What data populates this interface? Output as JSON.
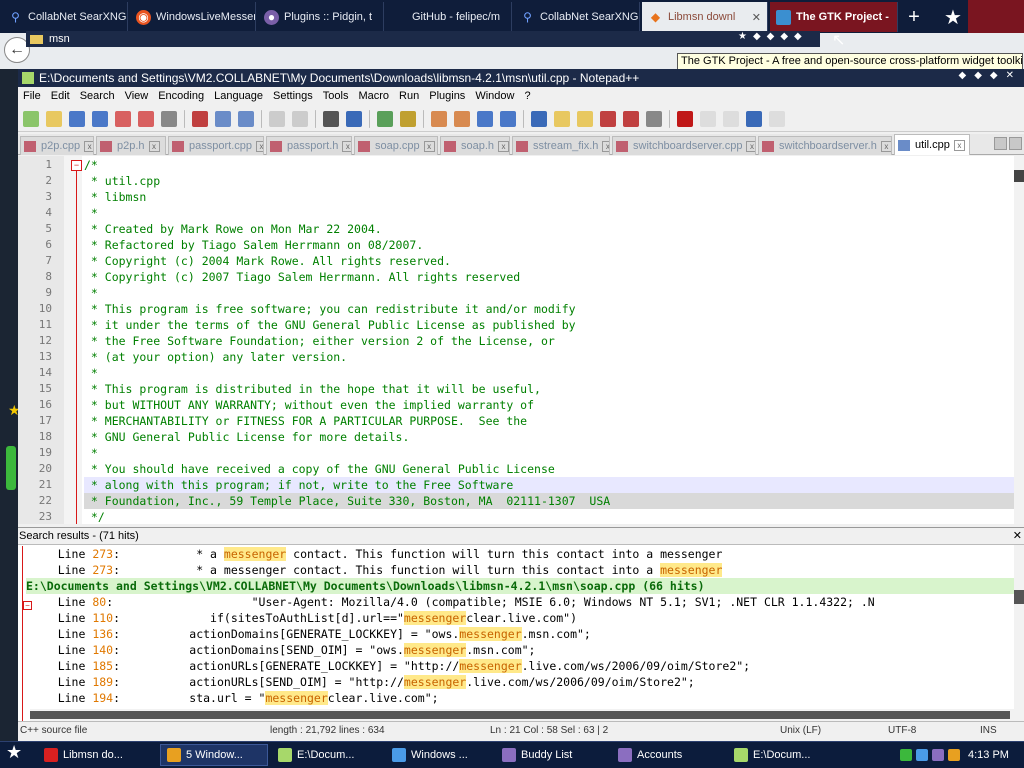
{
  "browser": {
    "tabs": [
      {
        "label": "CollabNet SearXNG",
        "icon": "search-icon"
      },
      {
        "label": "WindowsLiveMessenger",
        "icon": "ubuntu-icon"
      },
      {
        "label": "Plugins :: Pidgin, t",
        "icon": "pidgin-icon"
      },
      {
        "label": "GitHub - felipec/m",
        "icon": "github-icon"
      },
      {
        "label": "CollabNet SearXNG",
        "icon": "search-icon"
      },
      {
        "label": "Libmsn downl",
        "icon": "sourceforge-icon"
      },
      {
        "label": "The GTK Project -",
        "icon": "gtk-icon"
      }
    ],
    "address": "msn",
    "tooltip": "The GTK Project - A free and open-source cross-platform widget toolkit"
  },
  "npp": {
    "title": "E:\\Documents and Settings\\VM2.COLLABNET\\My Documents\\Downloads\\libmsn-4.2.1\\msn\\util.cpp - Notepad++",
    "menu": [
      "File",
      "Edit",
      "Search",
      "View",
      "Encoding",
      "Language",
      "Settings",
      "Tools",
      "Macro",
      "Run",
      "Plugins",
      "Window",
      "?"
    ],
    "doc_tabs": [
      "p2p.cpp",
      "p2p.h",
      "passport.cpp",
      "passport.h",
      "soap.cpp",
      "soap.h",
      "sstream_fix.h",
      "switchboardserver.cpp",
      "switchboardserver.h",
      "util.cpp"
    ],
    "editor_lines": [
      "/*",
      " * util.cpp",
      " * libmsn",
      " *",
      " * Created by Mark Rowe on Mon Mar 22 2004.",
      " * Refactored by Tiago Salem Herrmann on 08/2007.",
      " * Copyright (c) 2004 Mark Rowe. All rights reserved.",
      " * Copyright (c) 2007 Tiago Salem Herrmann. All rights reserved",
      " *",
      " * This program is free software; you can redistribute it and/or modify",
      " * it under the terms of the GNU General Public License as published by",
      " * the Free Software Foundation; either version 2 of the License, or",
      " * (at your option) any later version.",
      " *",
      " * This program is distributed in the hope that it will be useful,",
      " * but WITHOUT ANY WARRANTY; without even the implied warranty of",
      " * MERCHANTABILITY or FITNESS FOR A PARTICULAR PURPOSE.  See the",
      " * GNU General Public License for more details.",
      " *",
      " * You should have received a copy of the GNU General Public License",
      " * along with this program; if not, write to the Free Software",
      " * Foundation, Inc., 59 Temple Place, Suite 330, Boston, MA  02111-1307  USA",
      " */"
    ],
    "search": {
      "header": "Search results - (71 hits)",
      "results": [
        {
          "line": "Line 273:",
          "pre": "           * a ",
          "hit": "messenger",
          "post": " contact. This function will turn this contact into a messenger"
        },
        {
          "line": "Line 273:",
          "pre": "           * a messenger contact. This function will turn this contact into a ",
          "hit": "messenger",
          "post": ""
        },
        {
          "file": "E:\\Documents and Settings\\VM2.COLLABNET\\My Documents\\Downloads\\libmsn-4.2.1\\msn\\soap.cpp (66 hits)"
        },
        {
          "line": "Line 80:",
          "pre": "                    \"User-Agent: Mozilla/4.0 (compatible; MSIE 6.0; Windows NT 5.1; SV1; .NET CLR 1.1.4322; .N",
          "hit": "",
          "post": ""
        },
        {
          "line": "Line 110:",
          "pre": "             if(sitesToAuthList[d].url==\"",
          "hit": "messenger",
          "post": "clear.live.com\")"
        },
        {
          "line": "Line 136:",
          "pre": "          actionDomains[GENERATE_LOCKKEY] = \"ows.",
          "hit": "messenger",
          "post": ".msn.com\";"
        },
        {
          "line": "Line 140:",
          "pre": "          actionDomains[SEND_OIM] = \"ows.",
          "hit": "messenger",
          "post": ".msn.com\";"
        },
        {
          "line": "Line 185:",
          "pre": "          actionURLs[GENERATE_LOCKKEY] = \"http://",
          "hit": "messenger",
          "post": ".live.com/ws/2006/09/oim/Store2\";"
        },
        {
          "line": "Line 189:",
          "pre": "          actionURLs[SEND_OIM] = \"http://",
          "hit": "messenger",
          "post": ".live.com/ws/2006/09/oim/Store2\";"
        },
        {
          "line": "Line 194:",
          "pre": "          sta.url = \"",
          "hit": "messenger",
          "post": "clear.live.com\";"
        }
      ]
    },
    "status": {
      "type": "C++ source file",
      "length": "length : 21,792    lines : 634",
      "pos": "Ln : 21    Col : 58    Sel : 63 | 2",
      "eol": "Unix (LF)",
      "enc": "UTF-8",
      "ins": "INS"
    }
  },
  "taskbar": {
    "items": [
      "Libmsn do...",
      "5 Window...",
      "E:\\Docum...",
      "Windows ...",
      "Buddy List",
      "Accounts",
      "E:\\Docum..."
    ],
    "clock": "4:13 PM"
  },
  "colors": {
    "accent": "#7a1520",
    "comment": "#008000",
    "hit": "#ffe98a",
    "file_row": "#d8f4cc"
  }
}
